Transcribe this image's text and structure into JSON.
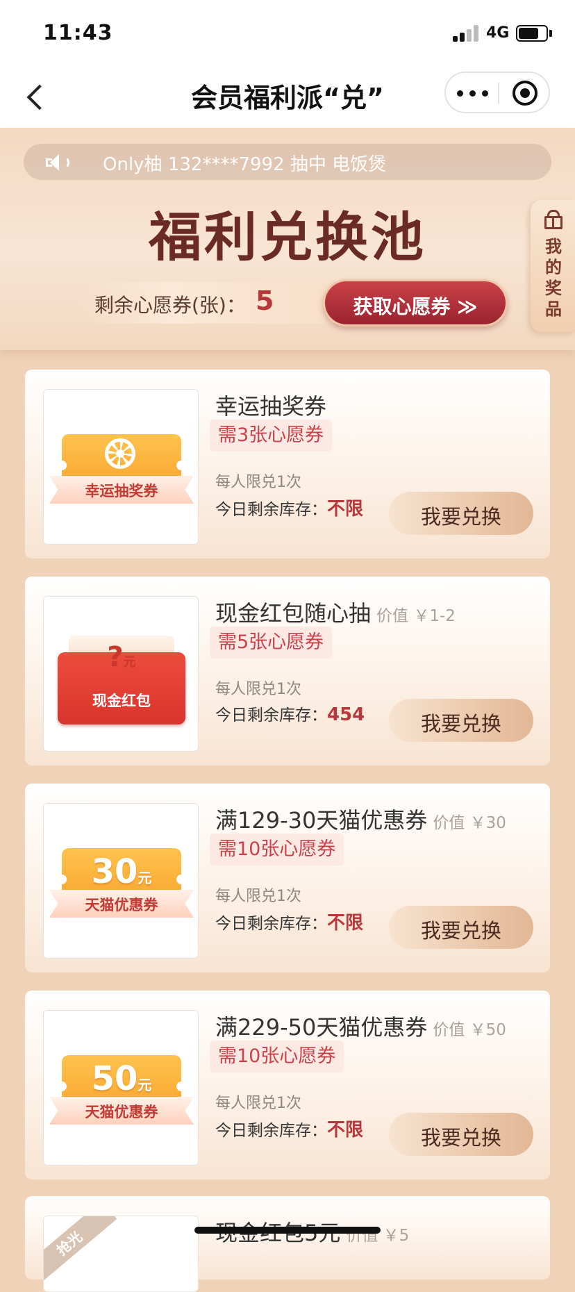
{
  "status_bar": {
    "time": "11:43",
    "network": "4G"
  },
  "nav": {
    "title": "会员福利派“兑”"
  },
  "hero": {
    "broadcast": "Only柚 132****7992 抽中 电饭煲",
    "title": "福利兑换池",
    "voucher_label": "剩余心愿券(张)：",
    "voucher_count": "5",
    "get_button": "获取心愿券 ≫",
    "my_prizes": "我的奖品"
  },
  "items": [
    {
      "name": "幸运抽奖券",
      "value": "",
      "requirement": "需3张心愿券",
      "limit": "每人限兑1次",
      "stock_label": "今日剩余库存：",
      "stock": "不限",
      "button": "我要兑换",
      "thumb": {
        "kind": "ticket",
        "label": "幸运抽奖券",
        "icon": "wheel-icon"
      }
    },
    {
      "name": "现金红包随心抽",
      "value": "价值 ￥1-2",
      "requirement": "需5张心愿券",
      "limit": "每人限兑1次",
      "stock_label": "今日剩余库存：",
      "stock": "454",
      "button": "我要兑换",
      "thumb": {
        "kind": "envelope",
        "amount": "?",
        "unit": "元",
        "label": "现金红包"
      }
    },
    {
      "name": "满129-30天猫优惠券",
      "value": "价值 ￥30",
      "requirement": "需10张心愿券",
      "limit": "每人限兑1次",
      "stock_label": "今日剩余库存：",
      "stock": "不限",
      "button": "我要兑换",
      "thumb": {
        "kind": "ticket",
        "amount": "30",
        "unit": "元",
        "label": "天猫优惠券"
      }
    },
    {
      "name": "满229-50天猫优惠券",
      "value": "价值 ￥50",
      "requirement": "需10张心愿券",
      "limit": "每人限兑1次",
      "stock_label": "今日剩余库存：",
      "stock": "不限",
      "button": "我要兑换",
      "thumb": {
        "kind": "ticket",
        "amount": "50",
        "unit": "元",
        "label": "天猫优惠券"
      }
    }
  ],
  "partial_item": {
    "name": "现金红包5元",
    "value": "价值 ￥5",
    "badge": "抢光"
  },
  "colors": {
    "accent_red": "#b6383d",
    "title_brown": "#6a2a26",
    "tag_bg": "#fde9e4",
    "button_tan": "#e2b794"
  }
}
